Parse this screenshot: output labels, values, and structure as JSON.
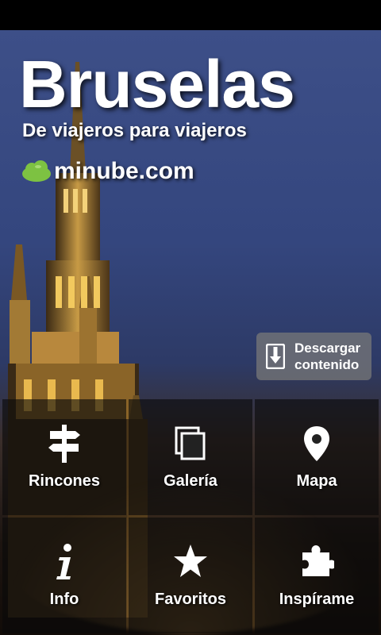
{
  "header": {
    "title": "Bruselas",
    "subtitle": "De viajeros para viajeros",
    "brand": "minube.com"
  },
  "download_button": {
    "line1": "Descargar",
    "line2": "contenido",
    "icon": "download-icon"
  },
  "menu": {
    "items": [
      {
        "label": "Rincones",
        "icon": "signpost-icon"
      },
      {
        "label": "Galería",
        "icon": "gallery-icon"
      },
      {
        "label": "Mapa",
        "icon": "map-pin-icon"
      },
      {
        "label": "Info",
        "icon": "info-icon"
      },
      {
        "label": "Favoritos",
        "icon": "star-icon"
      },
      {
        "label": "Inspírame",
        "icon": "puzzle-icon"
      }
    ]
  },
  "colors": {
    "brand_green": "#7dc242",
    "tile_bg": "#0a0a0a"
  }
}
